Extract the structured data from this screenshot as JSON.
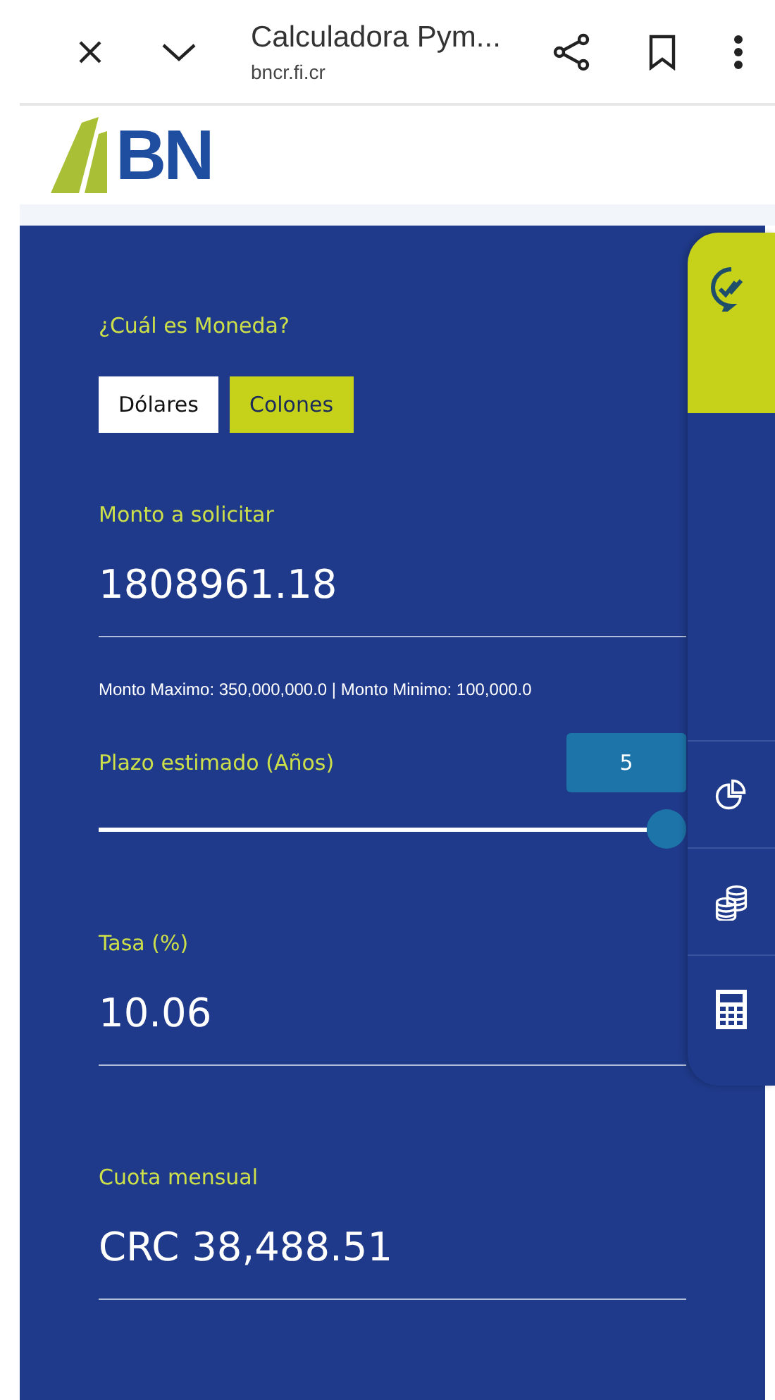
{
  "browser": {
    "title": "Calculadora Pym...",
    "url": "bncr.fi.cr"
  },
  "logo": {
    "text": "BN"
  },
  "currency": {
    "label": "¿Cuál es Moneda?",
    "options": [
      {
        "label": "Dólares",
        "selected": false
      },
      {
        "label": "Colones",
        "selected": true
      }
    ]
  },
  "amount": {
    "label": "Monto a solicitar",
    "value": "1808961.18",
    "note": "Monto Maximo: 350,000,000.0 | Monto Minimo: 100,000.0"
  },
  "term": {
    "label": "Plazo estimado (Años)",
    "reading": "5",
    "level": 1
  },
  "rate": {
    "label": "Tasa (%)",
    "value": "10.06"
  },
  "payment": {
    "label": "Cuota mensual",
    "value": "CRC 38,488.51"
  }
}
